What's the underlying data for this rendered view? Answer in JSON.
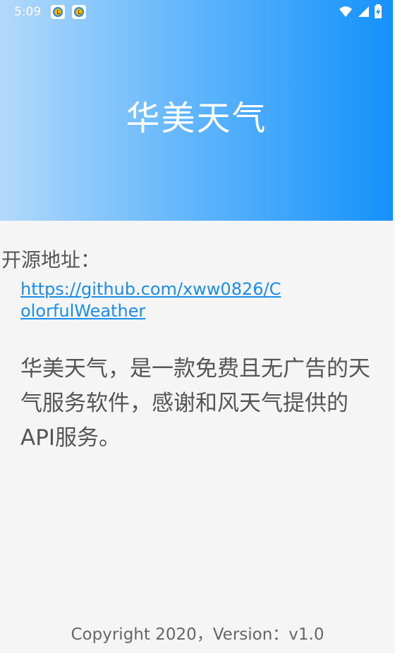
{
  "status_bar": {
    "time": "5:09",
    "icons": [
      "alarm-icon",
      "alarm-icon",
      "wifi-icon",
      "signal-icon",
      "battery-icon"
    ]
  },
  "header": {
    "title": "华美天气"
  },
  "about": {
    "source_label": "开源地址：",
    "repo_url": "https://github.com/xww0826/ColorfulWeather",
    "description": "华美天气，是一款免费且无广告的天气服务软件，感谢和风天气提供的API服务。"
  },
  "footer": {
    "copyright": "Copyright 2020，Version：v1.0"
  },
  "colors": {
    "header_gradient_start": "#b2d9fb",
    "header_gradient_end": "#1592fb",
    "link": "#1a8ee8",
    "text": "#555555"
  }
}
